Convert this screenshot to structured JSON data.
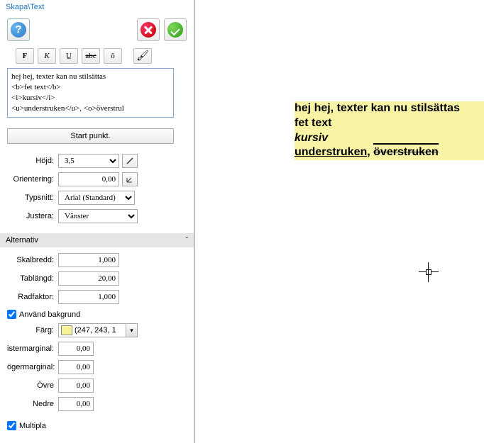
{
  "title": "Skapa\\Text",
  "icons": {
    "help": "?",
    "bold": "F",
    "italic": "K",
    "underline": "U̲",
    "strike": "abc",
    "over": "ō",
    "brush": "🖌"
  },
  "textarea_value": "hej hej, texter kan nu stilsättas\n<b>fet text</b>\n<i>kursiv</i>\n<u>understruken</u>, <o>överstrul",
  "start_btn": "Start punkt.",
  "fields": {
    "height_label": "Höjd:",
    "height_value": "3,5",
    "orient_label": "Orientering:",
    "orient_value": "0,00",
    "font_label": "Typsnitt:",
    "font_value": "Arial (Standard)",
    "justify_label": "Justera:",
    "justify_value": "Vänster"
  },
  "alt_section": "Alternativ",
  "alt": {
    "scalew_label": "Skalbredd:",
    "scalew_value": "1,000",
    "tablen_label": "Tablängd:",
    "tablen_value": "20,00",
    "rowf_label": "Radfaktor:",
    "rowf_value": "1,000"
  },
  "bg_check_label": "Använd bakgrund",
  "bg": {
    "color_label": "Färg:",
    "color_text": "(247, 243, 1",
    "left_label": "istermarginal:",
    "left_value": "0,00",
    "right_label": "ögermarginal:",
    "right_value": "0,00",
    "top_label": "Övre",
    "top_value": "0,00",
    "bottom_label": "Nedre",
    "bottom_value": "0,00"
  },
  "multi_label": "Multipla",
  "preview": {
    "l1": "hej hej, texter kan nu stilsättas",
    "l2": "fet text",
    "l3": "kursiv",
    "l4a": "understruken",
    "l4sep": ", ",
    "l4b": "överstruken"
  }
}
